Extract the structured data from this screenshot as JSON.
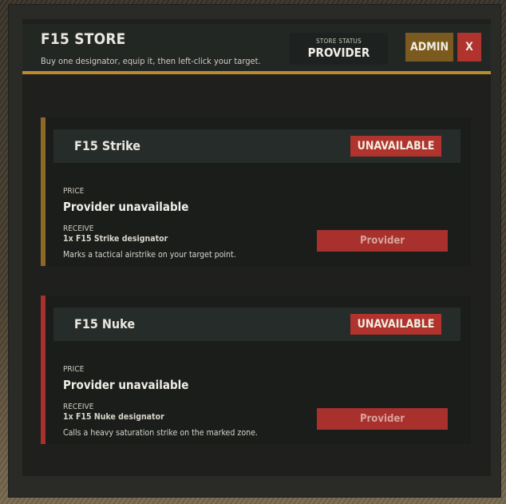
{
  "header": {
    "title": "F15 STORE",
    "subtitle": "Buy one designator, equip it, then left-click your target.",
    "status_label": "STORE STATUS",
    "status_value": "PROVIDER",
    "admin_label": "ADMIN",
    "close_label": "X"
  },
  "items": [
    {
      "name": "F15 Strike",
      "badge": "UNAVAILABLE",
      "price_label": "PRICE",
      "price_value": "Provider unavailable",
      "receive_label": "RECEIVE",
      "receive_item": "1x F15 Strike designator",
      "description": "Marks a tactical airstrike on your target point.",
      "button_label": "Provider",
      "accent": "#8c6a26"
    },
    {
      "name": "F15 Nuke",
      "badge": "UNAVAILABLE",
      "price_label": "PRICE",
      "price_value": "Provider unavailable",
      "receive_label": "RECEIVE",
      "receive_item": "1x F15 Nuke designator",
      "description": "Calls a heavy saturation strike on the marked zone.",
      "button_label": "Provider",
      "accent": "#a8302d"
    }
  ],
  "colors": {
    "header_rule": "#b88b2e",
    "unavailable": "#b0332e",
    "admin": "#7a5a1e"
  }
}
